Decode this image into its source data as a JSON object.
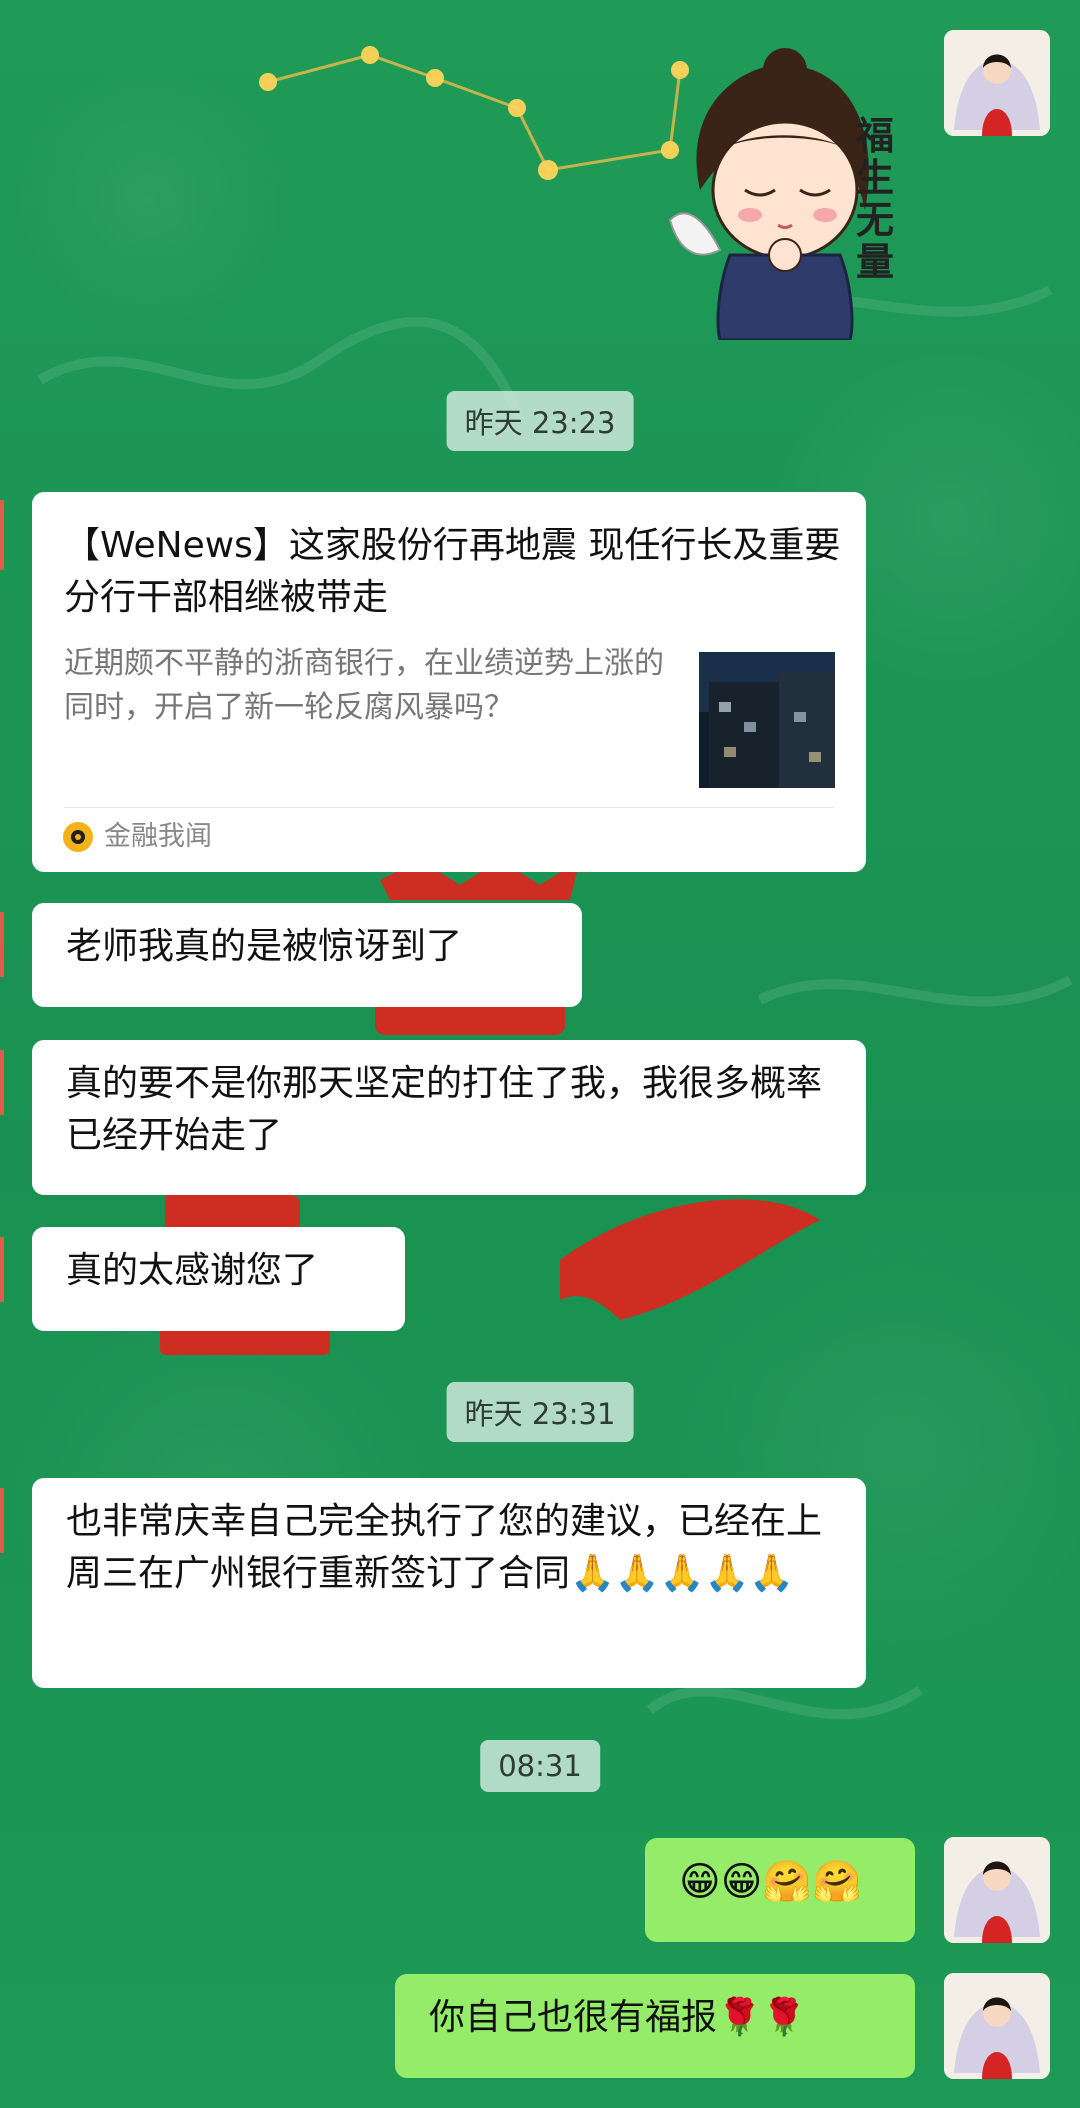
{
  "chat": {
    "sticker": {
      "caption": "福生无量"
    },
    "timestamps": [
      "昨天 23:23",
      "昨天 23:31",
      "08:31"
    ],
    "article": {
      "title": "【WeNews】这家股份行再地震 现任行长及重要分行干部相继被带走",
      "description": "近期颇不平静的浙商银行，在业绩逆势上涨的同时，开启了新一轮反腐风暴吗？",
      "source": "金融我闻"
    },
    "messages": [
      "老师我真的是被惊讶到了",
      "真的要不是你那天坚定的打住了我，我很多概率已经开始走了",
      "真的太感谢您了",
      "也非常庆幸自己完全执行了您的建议，已经在上周三在广州银行重新签订了合同🙏🙏🙏🙏🙏",
      "😁😁🤗🤗",
      "你自己也很有福报🌹🌹"
    ]
  },
  "colors": {
    "background": "#1f9a57",
    "incoming_bubble": "#ffffff",
    "outgoing_bubble": "#95ec69",
    "timestamp_bg": "#cde8dc"
  }
}
